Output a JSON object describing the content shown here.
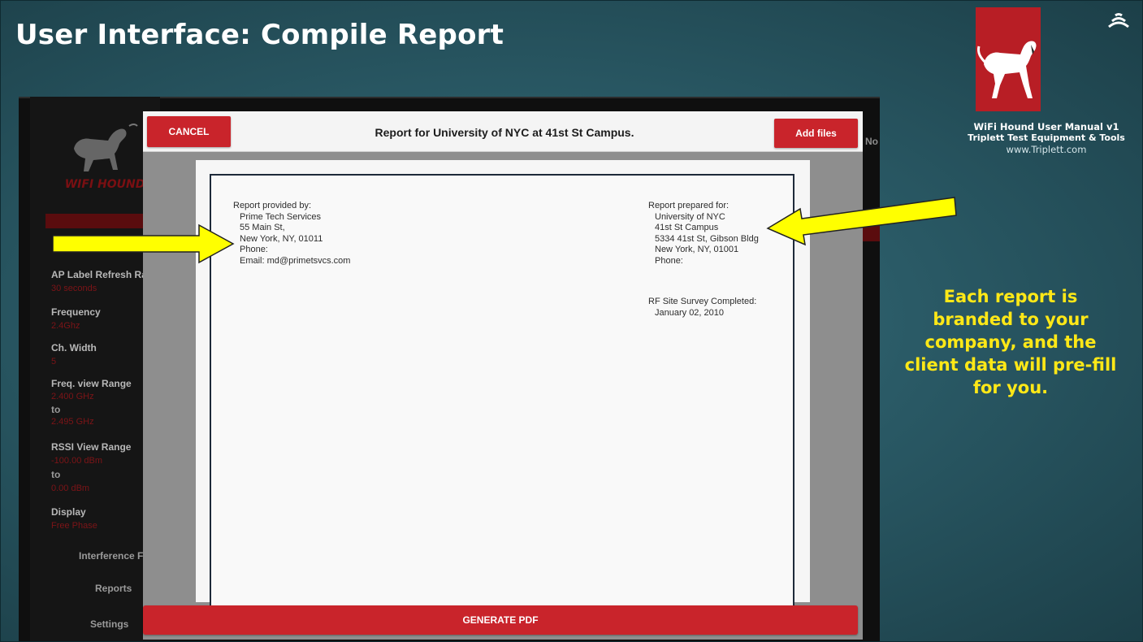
{
  "slide": {
    "title": "User Interface: Compile Report",
    "meta_line1": "WiFi Hound User Manual v1",
    "meta_line2": "Triplett Test Equipment & Tools",
    "meta_line3": "www.Triplett.com",
    "callout": "Each report is branded to your company, and the client data will pre-fill for you.",
    "callout_color": "#ffe817",
    "background_color": "#2b5660"
  },
  "app_sidebar": {
    "brand": "WIFI HOUND",
    "items": [
      {
        "label": "AP Label Refresh Ra",
        "value": "30 seconds"
      },
      {
        "label": "Frequency",
        "value": "2.4Ghz"
      },
      {
        "label": "Ch. Width",
        "value": "5"
      },
      {
        "label": "Freq. view Range",
        "value": "2.400 GHz",
        "to": "to",
        "value2": "2.495 GHz"
      },
      {
        "label": "RSSI View Range",
        "value": "-100.00 dBm",
        "to": "to",
        "value2": "0.00 dBm"
      },
      {
        "label": "Display",
        "value": "Free Phase"
      }
    ],
    "nav": [
      "Interference Filte",
      "Reports",
      "Settings"
    ],
    "right_stub": "No"
  },
  "dialog": {
    "cancel_label": "CANCEL",
    "title": "Report for University of NYC at 41st St Campus.",
    "add_files_label": "Add files",
    "generate_label": "GENERATE PDF",
    "accent_color": "#c9242b"
  },
  "report": {
    "provided_by": {
      "heading": "Report provided by:",
      "lines": [
        "Prime Tech Services",
        "55 Main St,",
        "New York, NY, 01011",
        "Phone:",
        "Email: md@primetsvcs.com"
      ]
    },
    "prepared_for": {
      "heading": "Report prepared for:",
      "lines": [
        "University of NYC",
        "41st St Campus",
        "5334 41st St, Gibson Bldg",
        "New York, NY, 01001",
        "Phone:"
      ]
    },
    "survey": {
      "heading": "RF Site Survey Completed:",
      "date": "January 02, 2010"
    }
  },
  "icons": {
    "logo": "hound-dog-icon",
    "wifi": "wifi-signal-icon",
    "arrow_color": "#ffff00"
  }
}
